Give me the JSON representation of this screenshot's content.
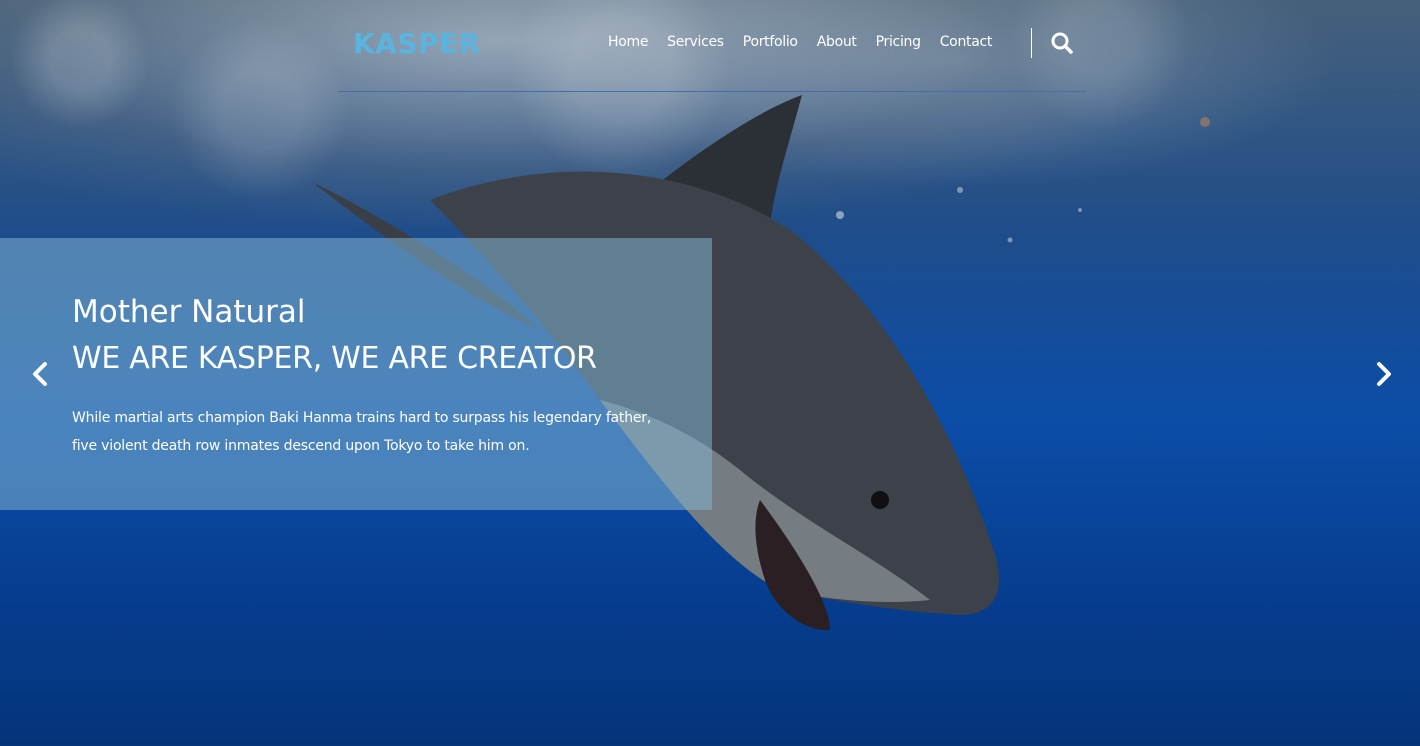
{
  "header": {
    "logo": "KASPER",
    "nav": [
      "Home",
      "Services",
      "Portfolio",
      "About",
      "Pricing",
      "Contact"
    ]
  },
  "slide": {
    "title": "Mother Natural",
    "heading": "WE ARE KASPER, WE ARE CREATOR",
    "text": "While martial arts champion Baki Hanma trains hard to surpass his legendary father, five violent death row inmates descend upon Tokyo to take him on."
  },
  "icons": {
    "search": "search-icon",
    "prev": "chevron-left-icon",
    "next": "chevron-right-icon"
  },
  "colors": {
    "logo": "#59b4e0",
    "caption_bg": "#80b2d0",
    "header_border": "#3f6fae"
  }
}
